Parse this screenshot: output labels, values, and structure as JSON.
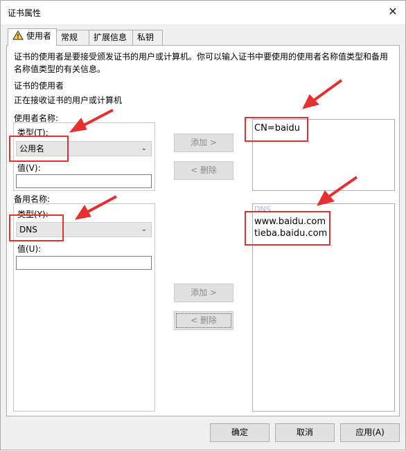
{
  "window": {
    "title": "证书属性"
  },
  "tabs": [
    {
      "label": "使用者",
      "active": true
    },
    {
      "label": "常规",
      "active": false
    },
    {
      "label": "扩展信息",
      "active": false
    },
    {
      "label": "私钥",
      "active": false
    }
  ],
  "panel": {
    "description": "证书的使用者是要接受颁发证书的用户或计算机。你可以输入证书中要使用的使用者名称值类型和备用名称值类型的有关信息。",
    "subject_heading": "证书的使用者",
    "subject_sub": "正在接收证书的用户或计算机",
    "subject_name": {
      "group_label": "使用者名称:",
      "type_label": "类型(T):",
      "type_value": "公用名",
      "value_label": "值(V):",
      "value": "",
      "add_label": "添加 >",
      "remove_label": "< 删除",
      "list": [
        "CN=baidu"
      ]
    },
    "alt_name": {
      "group_label": "备用名称:",
      "type_label": "类型(Y):",
      "type_value": "DNS",
      "value_label": "值(U):",
      "value": "",
      "add_label": "添加 >",
      "remove_label": "< 删除",
      "list_header": "DNS",
      "list": [
        "www.baidu.com",
        "tieba.baidu.com"
      ]
    }
  },
  "footer": {
    "ok": "确定",
    "cancel": "取消",
    "apply": "应用(A)"
  },
  "colors": {
    "annotation": "#e53030",
    "dialog_bg": "#f0f0f0"
  }
}
